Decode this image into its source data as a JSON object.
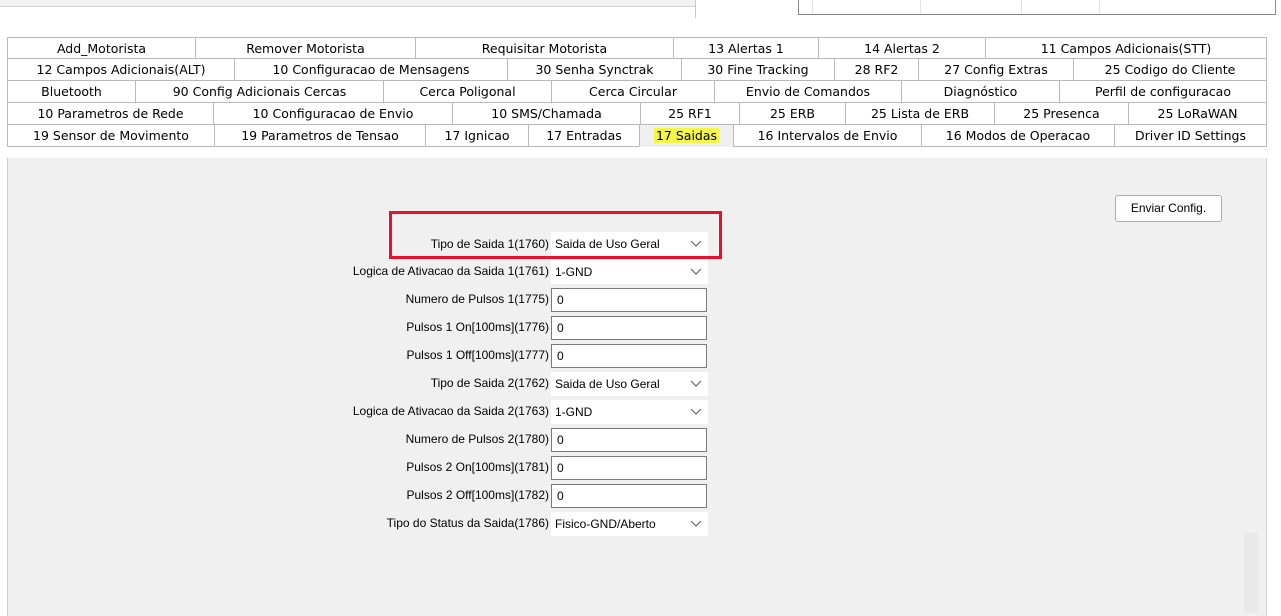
{
  "tabs": {
    "rows": [
      [
        "Add_Motorista",
        "Remover Motorista",
        "Requisitar Motorista",
        "13 Alertas 1",
        "14 Alertas 2",
        "11 Campos Adicionais(STT)"
      ],
      [
        "12 Campos Adicionais(ALT)",
        "10 Configuracao de Mensagens",
        "30 Senha Synctrak",
        "30 Fine Tracking",
        "28 RF2",
        "27 Config Extras",
        "25 Codigo do Cliente"
      ],
      [
        "Bluetooth",
        "90 Config Adicionais Cercas",
        "Cerca Poligonal",
        "Cerca Circular",
        "Envio de Comandos",
        "Diagnóstico",
        "Perfil de configuracao"
      ],
      [
        "10 Parametros de Rede",
        "10 Configuracao de Envio",
        "10 SMS/Chamada",
        "25 RF1",
        "25 ERB",
        "25 Lista de ERB",
        "25 Presenca",
        "25 LoRaWAN"
      ],
      [
        "19 Sensor de Movimento",
        "19 Parametros de Tensao",
        "17 Ignicao",
        "17 Entradas",
        "17 Saidas",
        "16 Intervalos de Envio",
        "16 Modos de Operacao",
        "Driver ID Settings"
      ]
    ],
    "active": "17 Saidas",
    "highlight_color": "#f6f64a"
  },
  "panel": {
    "send_button": "Enviar Config.",
    "highlight_border_color": "#e8112d",
    "fields": [
      {
        "label": "Tipo de Saida 1(1760)",
        "type": "combo",
        "value": "Saida de Uso Geral"
      },
      {
        "label": "Logica de Ativacao da Saida 1(1761)",
        "type": "combo",
        "value": "1-GND"
      },
      {
        "label": "Numero de Pulsos 1(1775)",
        "type": "text",
        "value": "0"
      },
      {
        "label": "Pulsos 1 On[100ms](1776)",
        "type": "text",
        "value": "0"
      },
      {
        "label": "Pulsos 1 Off[100ms](1777)",
        "type": "text",
        "value": "0"
      },
      {
        "label": "Tipo de Saida 2(1762)",
        "type": "combo",
        "value": "Saida de Uso Geral"
      },
      {
        "label": "Logica de Ativacao da Saida 2(1763)",
        "type": "combo",
        "value": "1-GND"
      },
      {
        "label": "Numero de Pulsos 2(1780)",
        "type": "text",
        "value": "0"
      },
      {
        "label": "Pulsos 2 On[100ms](1781)",
        "type": "text",
        "value": "0"
      },
      {
        "label": "Pulsos 2 Off[100ms](1782)",
        "type": "text",
        "value": "0"
      },
      {
        "label": "Tipo do Status da Saida(1786)",
        "type": "combo",
        "value": "Fisico-GND/Aberto"
      }
    ]
  }
}
